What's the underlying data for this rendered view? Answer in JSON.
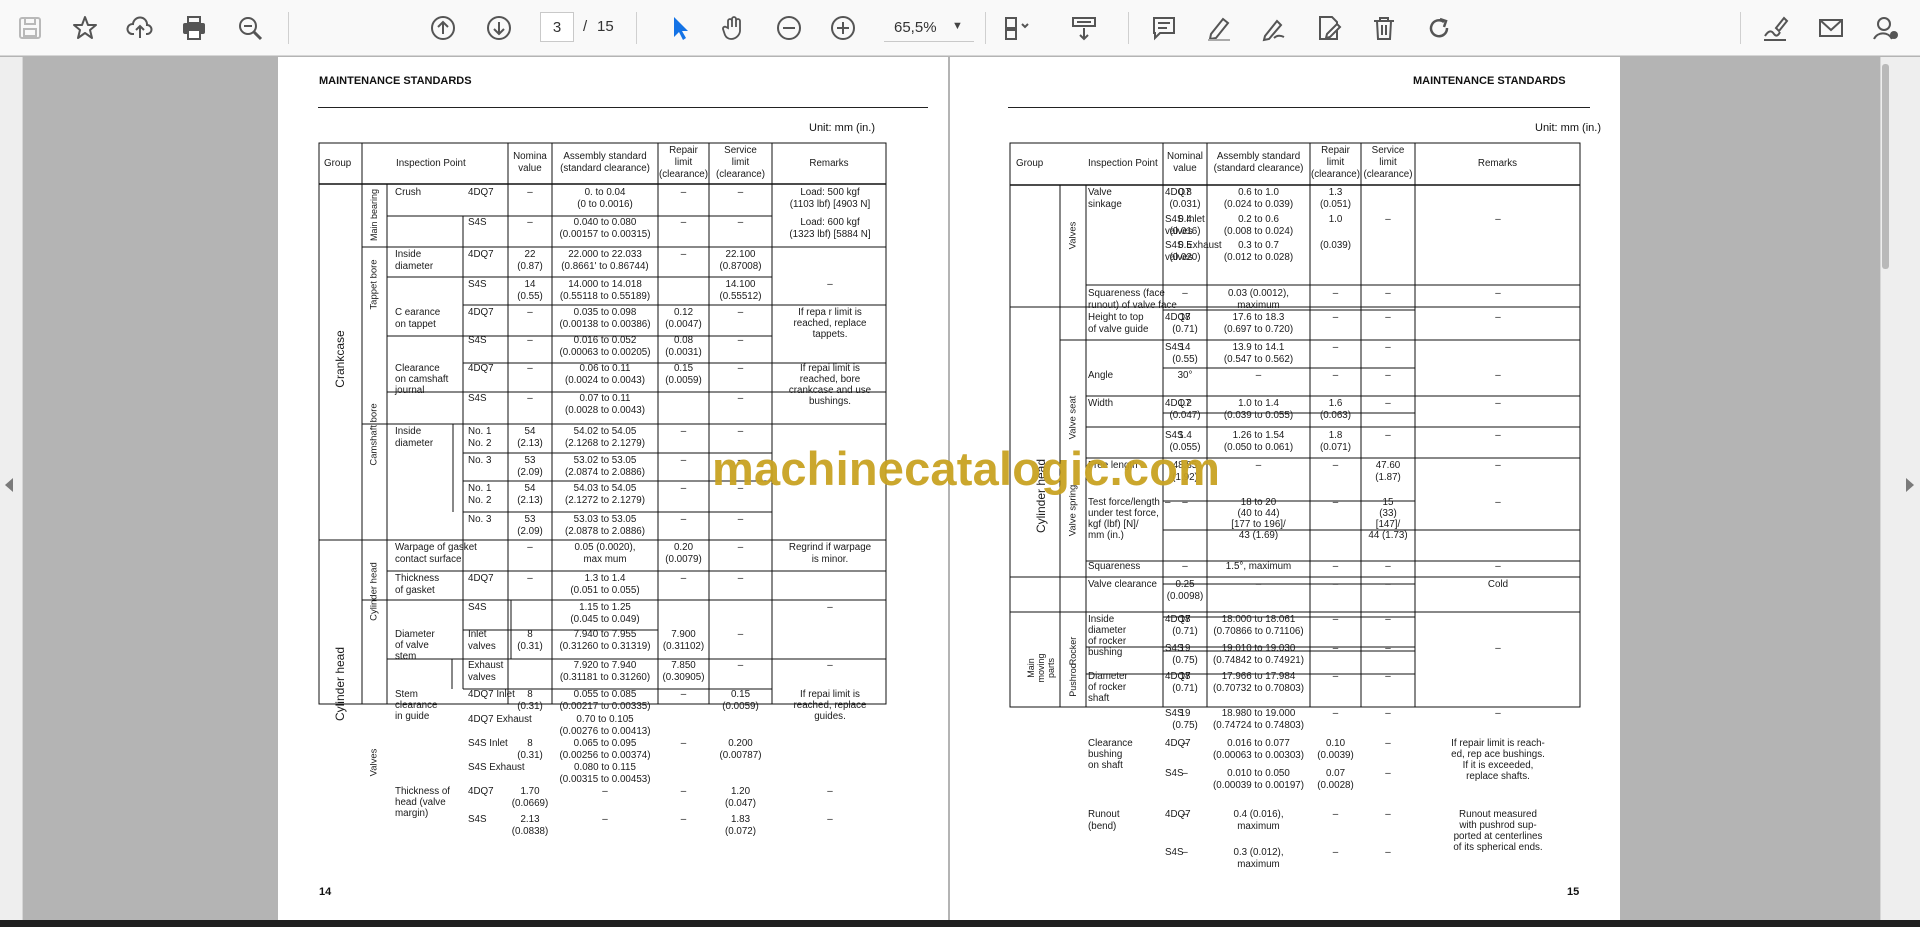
{
  "toolbar": {
    "page_current": "3",
    "page_sep": "/",
    "page_total": "15",
    "zoom": "65,5%",
    "icons": [
      "save-icon",
      "star-icon",
      "upload-icon",
      "print-icon",
      "zoom-search-icon",
      "page-up-icon",
      "page-down-icon",
      "hand-select-arrow-icon",
      "hand-icon",
      "zoom-out-icon",
      "zoom-in-icon",
      "fit-page-icon",
      "scroll-mode-icon",
      "comment-icon",
      "highlight-pen-icon",
      "draw-icon",
      "edit-pdf-icon",
      "delete-icon",
      "rotate-icon",
      "sign-icon",
      "mail-icon",
      "account-icon"
    ],
    "accent": "#1473e6"
  },
  "watermark": "machinecatalogic.com",
  "left_page": {
    "header": "MAINTENANCE STANDARDS",
    "unit": "Unit: mm (in.)",
    "page_number": "14",
    "cols": [
      "Group",
      "Inspection Point",
      "Nomina\nvalue",
      "Assembly standard\n(standard clearance)",
      "Repair\nlimit\n(clearance)",
      "Service\nlimit\n(clearance)",
      "Remarks"
    ],
    "groups": [
      "Crankcase",
      "Cylinder head"
    ],
    "subgroups": [
      "Main bearing",
      "Tappet bore",
      "Camshaft bore",
      "Cylinder head",
      "Valves"
    ],
    "cells": [
      [
        "Crush",
        "4DQ7",
        "–",
        "0. to 0.04\n(0 to 0.0016)",
        "–",
        "–",
        "Load: 500 kgf\n(1103 lbf) [4903 N]"
      ],
      [
        "",
        "S4S",
        "–",
        "0.040 to 0.080\n(0.00157 to 0.00315)",
        "–",
        "–",
        "Load: 600 kgf\n(1323 lbf) [5884 N]"
      ],
      [
        "Inside\ndiameter",
        "4DQ7",
        "22\n(0.87)",
        "22.000 to 22.033\n(0.8661' to 0.86744)",
        "–",
        "22.100\n(0.87008)",
        ""
      ],
      [
        "",
        "S4S",
        "14\n(0.55)",
        "14.000 to 14.018\n(0.55118 to 0.55189)",
        "",
        "14.100\n(0.55512)",
        "–"
      ],
      [
        "C earance\non tappet",
        "4DQ7",
        "–",
        "0.035 to 0.098\n(0.00138 to 0.00386)",
        "0.12\n(0.0047)",
        "–",
        "If repa r limit is\nreached, replace\ntappets."
      ],
      [
        "",
        "S4S",
        "–",
        "0.016 to 0.052\n(0.00063 to 0.00205)",
        "0.08\n(0.0031)",
        "–",
        ""
      ],
      [
        "Clearance\non camshaft\njournal",
        "4DQ7",
        "–",
        "0.06 to 0.11\n(0.0024 to 0.0043)",
        "0.15\n(0.0059)",
        "–",
        "If repai limit is\nreached, bore\ncrankcase and use\nbushings."
      ],
      [
        "",
        "S4S",
        "–",
        "0.07 to 0.11\n(0.0028 to 0.0043)",
        "",
        "–",
        ""
      ],
      [
        "Inside\ndiameter",
        "No. 1\nNo. 2",
        "54\n(2.13)",
        "54.02 to 54.05\n(2.1268 to 2.1279)",
        "–",
        "–",
        ""
      ],
      [
        "",
        "No. 3",
        "53\n(2.09)",
        "53.02 to 53.05\n(2.0874 to 2.0886)",
        "–",
        "–",
        ""
      ],
      [
        "",
        "No. 1\nNo. 2",
        "54\n(2.13)",
        "54.03 to 54.05\n(2.1272 to 2.1279)",
        "–",
        "–",
        ""
      ],
      [
        "",
        "No. 3",
        "53\n(2.09)",
        "53.03 to 53.05\n(2.0878 to 2.0886)",
        "–",
        "–",
        ""
      ],
      [
        "Warpage of gasket\ncontact surface",
        "",
        "–",
        "0.05 (0.0020),\nmax mum",
        "0.20\n(0.0079)",
        "–",
        "Regrind if warpage\nis minor."
      ],
      [
        "Thickness\nof gasket",
        "4DQ7",
        "–",
        "1.3 to 1.4\n(0.051 to 0.055)",
        "–",
        "–",
        ""
      ],
      [
        "",
        "S4S",
        "",
        "1.15 to 1.25\n(0.045 to 0.049)",
        "",
        "",
        "–"
      ],
      [
        "Diameter\nof valve\nstem",
        "Inlet\nvalves",
        "8\n(0.31)",
        "7.940 to 7.955\n(0.31260 to 0.31319)",
        "7.900\n(0.31102)",
        "–",
        ""
      ],
      [
        "",
        "Exhaust\nvalves",
        "",
        "7.920 to 7.940\n(0.31181 to 0.31260)",
        "7.850\n(0.30905)",
        "–",
        "–"
      ],
      [
        "Stem\nclearance\nin guide",
        "4DQ7 Inlet",
        "8\n(0.31)",
        "0.055 to 0.085\n(0.00217 to 0.00335)",
        "–",
        "0.15\n(0.0059)",
        "If repai limit is\nreached, replace\nguides."
      ],
      [
        "",
        "4DQ7 Exhaust",
        "",
        "0.70 to 0.105\n(0.00276 to 0.00413)",
        "",
        "",
        ""
      ],
      [
        "",
        "S4S Inlet",
        "8\n(0.31)",
        "0.065 to 0.095\n(0.00256 to 0.00374)",
        "–",
        "0.200\n(0.00787)",
        ""
      ],
      [
        "",
        "S4S Exhaust",
        "",
        "0.080 to 0.115\n(0.00315 to 0.00453)",
        "",
        "",
        ""
      ],
      [
        "Thickness of\nhead (valve\nmargin)",
        "4DQ7",
        "1.70\n(0.0669)",
        "–",
        "–",
        "1.20\n(0.047)",
        "–"
      ],
      [
        "",
        "S4S",
        "2.13\n(0.0838)",
        "–",
        "–",
        "1.83\n(0.072)",
        "–"
      ]
    ]
  },
  "right_page": {
    "header": "MAINTENANCE STANDARDS",
    "unit": "Unit: mm (in.)",
    "page_number": "15",
    "cols": [
      "Group",
      "Inspection Point",
      "Nominal\nvalue",
      "Assembly standard\n(standard clearance)",
      "Repair\nlimit\n(clearance)",
      "Service\nlimit\n(clearance)",
      "Remarks"
    ],
    "groups": [
      "Cylinder head",
      "Main\nmoving\nparts"
    ],
    "subgroups": [
      "Valves",
      "Valve seat",
      "Valve spring",
      "Rocker",
      "Pushrod"
    ],
    "cells": [
      [
        "Valve\nsinkage",
        "4DQ7",
        "0.8\n(0.031)",
        "0.6 to 1.0\n(0.024 to 0.039)",
        "1.3\n(0.051)",
        "",
        ""
      ],
      [
        "",
        "S4S Inlet\nvalves",
        "0.4\n(0.016)",
        "0.2 to 0.6\n(0.008 to 0.024)",
        "1.0",
        "–",
        "–"
      ],
      [
        "",
        "S4S Exhaust\nvalves",
        "0.5\n(0.020)",
        "0.3 to 0.7\n(0.012 to 0.028)",
        "(0.039)",
        "",
        ""
      ],
      [
        "Squareness (face\nrunout) of valve face",
        "",
        "–",
        "0.03 (0.0012),\nmaximum",
        "–",
        "–",
        "–"
      ],
      [
        "Height to top\nof valve guide",
        "4DQ7",
        "18\n(0.71)",
        "17.6 to 18.3\n(0.697 to 0.720)",
        "–",
        "–",
        "–"
      ],
      [
        "",
        "S4S",
        "14\n(0.55)",
        "13.9 to 14.1\n(0.547 to 0.562)",
        "–",
        "–",
        ""
      ],
      [
        "Angle",
        "",
        "30°",
        "–",
        "–",
        "–",
        "–"
      ],
      [
        "Width",
        "4DQ7",
        "1.2\n(0.047)",
        "1.0 to 1.4\n(0.039 to 0.055)",
        "1.6\n(0.063)",
        "–",
        "–"
      ],
      [
        "",
        "S4S",
        "1.4\n(0.055)",
        "1.26 to 1.54\n(0.050 to 0.061)",
        "1.8\n(0.071)",
        "–",
        "–"
      ],
      [
        "Free length",
        "",
        "48.85\n(1.92)",
        "–",
        "–",
        "47.60\n(1.87)",
        "–"
      ],
      [
        "Test force/length\nunder test force,\nkgf (lbf) [N]/\nmm (in.)",
        "–",
        "–",
        "18 to 20\n(40 to 44)\n[177 to 196]/\n43 (1.69)",
        "–",
        "15\n(33)\n[147]/\n44 (1.73)",
        "–"
      ],
      [
        "Squareness",
        "",
        "–",
        "1.5°, maximum",
        "–",
        "–",
        "–"
      ],
      [
        "Valve clearance",
        "",
        "0.25\n(0.0098)",
        "–",
        "–",
        "–",
        "Cold"
      ],
      [
        "Inside\ndiameter\nof rocker\nbushing",
        "4DQ7",
        "18\n(0.71)",
        "18.000 to 18.061\n(0.70866 to 0.71106)",
        "–",
        "–",
        ""
      ],
      [
        "",
        "S4S",
        "19\n(0.75)",
        "19.010 to 19.030\n(0.74842 to 0.74921)",
        "–",
        "–",
        "–"
      ],
      [
        "Diameter\nof rocker\nshaft",
        "4DQ7",
        "18\n(0.71)",
        "17.966 to 17.984\n(0.70732 to 0.70803)",
        "–",
        "–",
        ""
      ],
      [
        "",
        "S4S",
        "19\n(0.75)",
        "18.980 to 19.000\n(0.74724 to 0.74803)",
        "–",
        "–",
        "–"
      ],
      [
        "Clearance\nbushing\non shaft",
        "4DQ7",
        "–",
        "0.016 to 0.077\n(0.00063 to 0.00303)",
        "0.10\n(0.0039)",
        "–",
        "If repair limit is reach-\ned, rep ace bushings.\nIf it is exceeded,\nreplace shafts."
      ],
      [
        "",
        "S4S",
        "–",
        "0.010 to 0.050\n(0.00039 to 0.00197)",
        "0.07\n(0.0028)",
        "–",
        ""
      ],
      [
        "Runout\n(bend)",
        "4DQ7",
        "–",
        "0.4 (0.016),\nmaximum",
        "–",
        "–",
        "Runout measured\nwith pushrod sup-\nported at centerlines\nof its spherical ends."
      ],
      [
        "",
        "S4S",
        "–",
        "0.3 (0.012),\nmaximum",
        "–",
        "–",
        ""
      ]
    ]
  }
}
